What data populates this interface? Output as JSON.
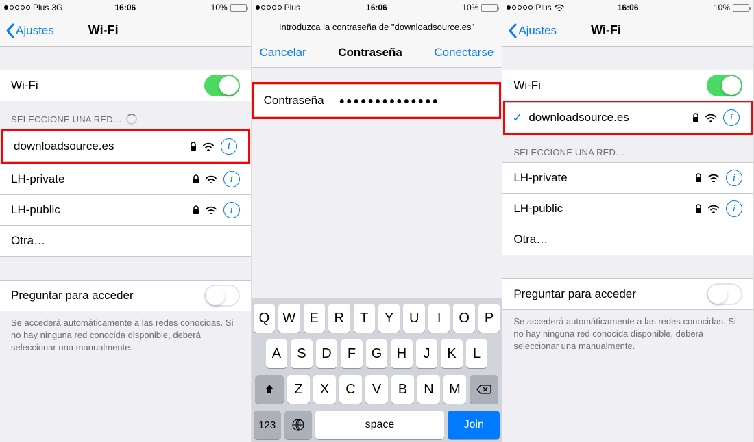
{
  "status": {
    "carrier": "Plus",
    "network": "3G",
    "time": "16:06",
    "battery_pct": "10%"
  },
  "screen1": {
    "back_label": "Ajustes",
    "title": "Wi-Fi",
    "wifi_label": "Wi-Fi",
    "section_header": "SELECCIONE UNA RED…",
    "networks": [
      {
        "name": "downloadsource.es",
        "locked": true
      },
      {
        "name": "LH-private",
        "locked": true
      },
      {
        "name": "LH-public",
        "locked": true
      }
    ],
    "other_label": "Otra…",
    "ask_label": "Preguntar para acceder",
    "footer": "Se accederá automáticamente a las redes conocidas. Si no hay ninguna red conocida disponible, deberá seleccionar una manualmente."
  },
  "screen2": {
    "prompt": "Introduzca la contraseña de \"downloadsource.es\"",
    "cancel": "Cancelar",
    "title": "Contraseña",
    "connect": "Conectarse",
    "pw_label": "Contraseña",
    "pw_value": "●●●●●●●●●●●●●●",
    "keyboard": {
      "row1": [
        "Q",
        "W",
        "E",
        "R",
        "T",
        "Y",
        "U",
        "I",
        "O",
        "P"
      ],
      "row2": [
        "A",
        "S",
        "D",
        "F",
        "G",
        "H",
        "J",
        "K",
        "L"
      ],
      "row3": [
        "Z",
        "X",
        "C",
        "V",
        "B",
        "N",
        "M"
      ],
      "num_key": "123",
      "space": "space",
      "join": "Join"
    }
  },
  "screen3": {
    "back_label": "Ajustes",
    "title": "Wi-Fi",
    "wifi_label": "Wi-Fi",
    "connected_network": "downloadsource.es",
    "section_header": "SELECCIONE UNA RED…",
    "networks": [
      {
        "name": "LH-private",
        "locked": true
      },
      {
        "name": "LH-public",
        "locked": true
      }
    ],
    "other_label": "Otra…",
    "ask_label": "Preguntar para acceder",
    "footer": "Se accederá automáticamente a las redes conocidas. Si no hay ninguna red conocida disponible, deberá seleccionar una manualmente."
  }
}
